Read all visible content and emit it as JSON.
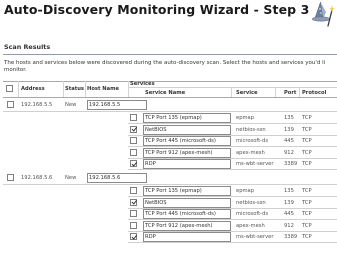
{
  "page": {
    "title": "Auto-Discovery Monitoring Wizard - Step 3",
    "section": "Scan Results",
    "description": "The hosts and services below were discovered during the auto-discovery scan. Select the hosts and services you'd li monitor."
  },
  "table": {
    "headers": {
      "address": "Address",
      "status": "Status",
      "host_name": "Host Name",
      "services": "Services",
      "service_name": "Service Name",
      "service": "Service",
      "port": "Port",
      "protocol": "Protocol"
    },
    "hosts": [
      {
        "address": "192.168.5.5",
        "status": "New",
        "host_name": "192.168.5.5",
        "checked": false,
        "services": [
          {
            "checked": false,
            "service_name": "TCP Port 135 (epmap)",
            "service": "epmap",
            "port": "135",
            "protocol": "TCP"
          },
          {
            "checked": true,
            "service_name": "NetBIOS",
            "service": "netbios-ssn",
            "port": "139",
            "protocol": "TCP"
          },
          {
            "checked": false,
            "service_name": "TCP Port 445 (microsoft-ds)",
            "service": "microsoft-ds",
            "port": "445",
            "protocol": "TCP"
          },
          {
            "checked": false,
            "service_name": "TCP Port 912 (apex-mesh)",
            "service": "apex-mesh",
            "port": "912",
            "protocol": "TCP"
          },
          {
            "checked": true,
            "service_name": "RDP",
            "service": "ms-wbt-server",
            "port": "3389",
            "protocol": "TCP"
          }
        ]
      },
      {
        "address": "192.168.5.6",
        "status": "New",
        "host_name": "192.168.5.6",
        "checked": false,
        "services": [
          {
            "checked": false,
            "service_name": "TCP Port 135 (epmap)",
            "service": "epmap",
            "port": "135",
            "protocol": "TCP"
          },
          {
            "checked": true,
            "service_name": "NetBIOS",
            "service": "netbios-ssn",
            "port": "139",
            "protocol": "TCP"
          },
          {
            "checked": false,
            "service_name": "TCP Port 445 (microsoft-ds)",
            "service": "microsoft-ds",
            "port": "445",
            "protocol": "TCP"
          },
          {
            "checked": false,
            "service_name": "TCP Port 912 (apex-mesh)",
            "service": "apex-mesh",
            "port": "912",
            "protocol": "TCP"
          },
          {
            "checked": true,
            "service_name": "RDP",
            "service": "ms-wbt-server",
            "port": "3389",
            "protocol": "TCP"
          }
        ]
      }
    ]
  },
  "icons": {
    "wizard": "wizard-hat-icon",
    "select_all": "select-all-checkbox"
  }
}
